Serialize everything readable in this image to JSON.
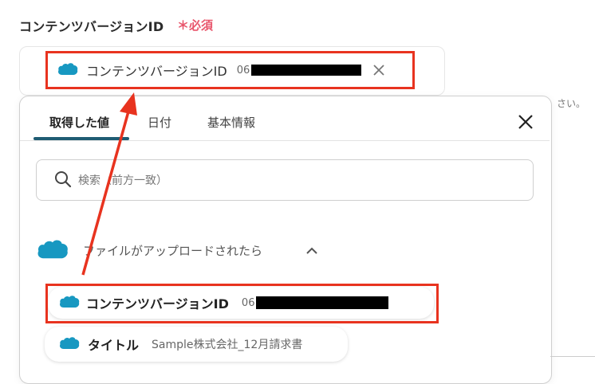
{
  "field": {
    "label": "コンテンツバージョンID",
    "required_mark": "＊必須",
    "hint_tail": "さい。",
    "selected_chip": {
      "label": "コンテンツバージョンID",
      "value_visible": "06"
    },
    "clear_icon": "close-icon"
  },
  "panel": {
    "tabs": [
      {
        "label": "取得した値",
        "active": true
      },
      {
        "label": "日付",
        "active": false
      },
      {
        "label": "基本情報",
        "active": false
      }
    ],
    "close_icon": "close-icon",
    "search": {
      "placeholder": "検索（前方一致）",
      "icon": "search-icon"
    },
    "group": {
      "title": "ファイルがアップロードされたら",
      "toggle_icon": "chevron-up-icon",
      "icon": "salesforce-cloud-icon"
    },
    "items": [
      {
        "label": "コンテンツバージョンID",
        "value_visible": "06"
      },
      {
        "label": "タイトル",
        "value": "Sample株式会社_12月請求書"
      }
    ]
  },
  "colors": {
    "salesforce_blue": "#1798c1",
    "highlight_red": "#e8331f",
    "required_pink": "#e8566c",
    "tab_underline": "#1f5c73"
  }
}
